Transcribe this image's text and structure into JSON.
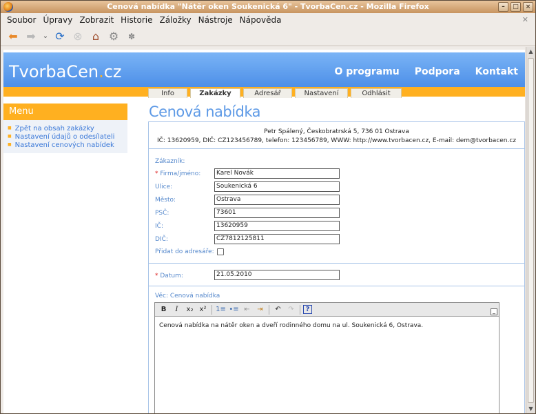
{
  "window": {
    "title": "Cenová nabídka \"Nátěr oken Soukenická 6\" - TvorbaCen.cz - Mozilla Firefox"
  },
  "menubar": [
    "Soubor",
    "Úpravy",
    "Zobrazit",
    "Historie",
    "Záložky",
    "Nástroje",
    "Nápověda"
  ],
  "site": {
    "logo_main": "TvorbaCen",
    "logo_dot": ".",
    "logo_tld": "cz",
    "nav": [
      "O programu",
      "Podpora",
      "Kontakt"
    ],
    "tabs": [
      "Info",
      "Zakázky",
      "Adresář",
      "Nastavení",
      "Odhlásit"
    ],
    "active_tab": "Zakázky"
  },
  "menu": {
    "title": "Menu",
    "items": [
      "Zpět na obsah zakázky",
      "Nastavení údajů o odesílateli",
      "Nastavení cenových nabídek"
    ]
  },
  "page": {
    "title": "Cenová nabídka"
  },
  "sender": {
    "line1": "Petr Spálený, Českobratrská 5, 736 01 Ostrava",
    "line2": "IČ: 13620959, DIČ: CZ123456789, telefon: 123456789, WWW: http://www.tvorbacen.cz, E-mail: dem@tvorbacen.cz"
  },
  "customer": {
    "section_label": "Zákazník:",
    "firm_label": "Firma/jméno:",
    "firm_value": "Karel Novák",
    "street_label": "Ulice:",
    "street_value": "Soukenická 6",
    "city_label": "Město:",
    "city_value": "Ostrava",
    "zip_label": "PSČ:",
    "zip_value": "73601",
    "ic_label": "IČ:",
    "ic_value": "13620959",
    "dic_label": "DIČ:",
    "dic_value": "CZ7812125811",
    "add_label": "Přidat do adresáře:",
    "required_mark": "*"
  },
  "date": {
    "label": "Datum:",
    "value": "21.05.2010"
  },
  "subject": {
    "label": "Věc: Cenová nabídka"
  },
  "editor": {
    "buttons": [
      "B",
      "I",
      "x₂",
      "x²",
      "1≡",
      "•≡",
      "⇤",
      "⇥",
      "↶",
      "↷",
      "?"
    ],
    "text": "Cenová nabídka na nátěr oken a dveří rodinného domu na ul. Soukenická 6, Ostrava."
  }
}
